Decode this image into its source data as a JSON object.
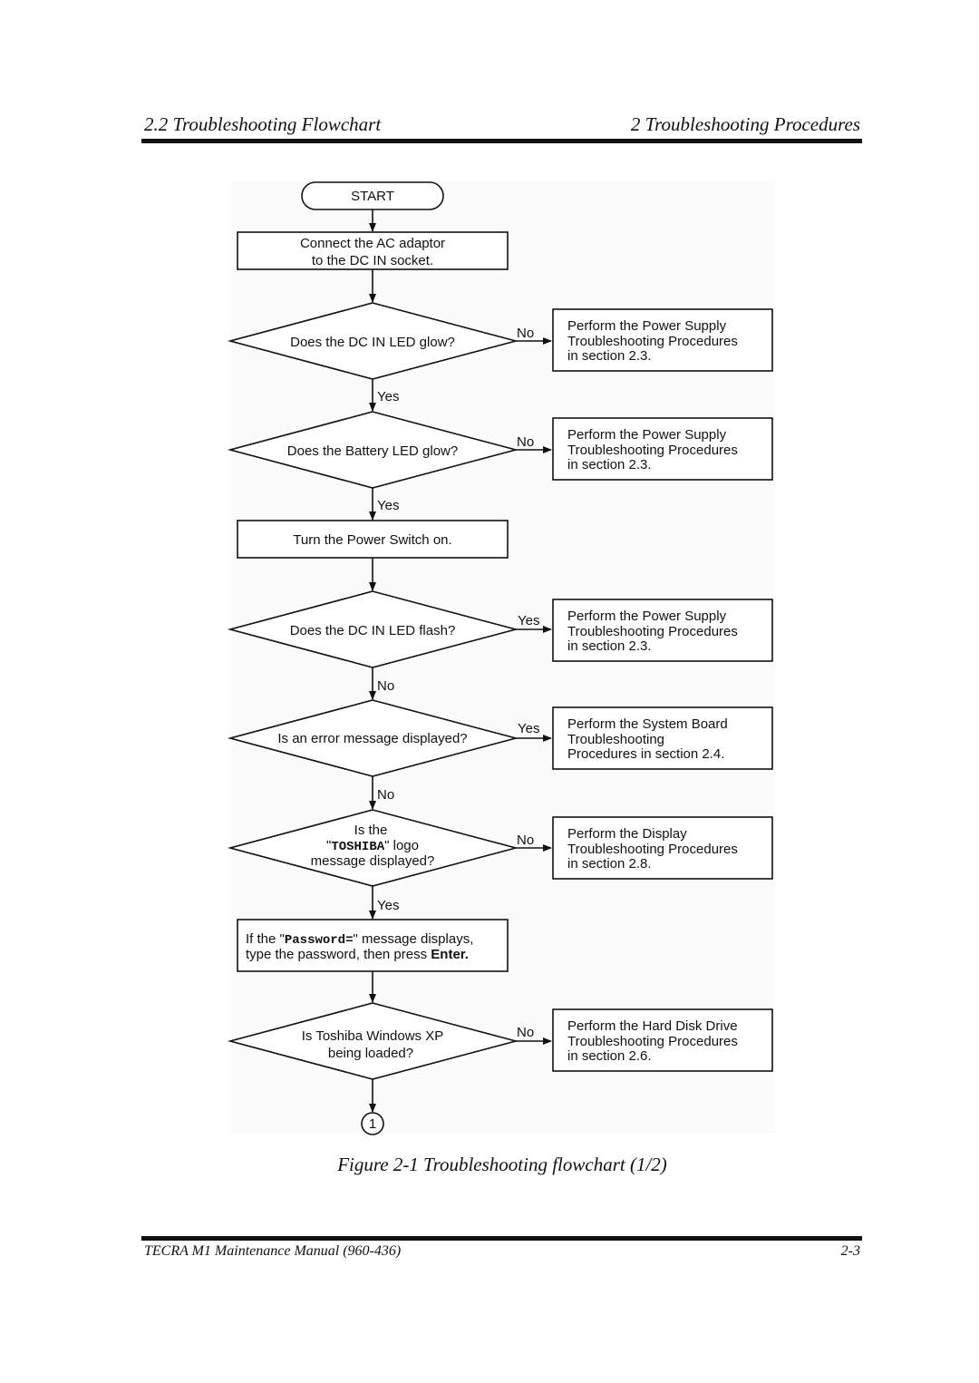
{
  "header": {
    "section_title": "2.2 Troubleshooting Flowchart",
    "chapter_title": "2  Troubleshooting Procedures"
  },
  "flowchart": {
    "start": "START",
    "step_connect": [
      "Connect the AC adaptor",
      "to the DC IN socket."
    ],
    "q1": {
      "text": [
        "Does the DC IN LED glow?"
      ],
      "side_label": "No",
      "down_label": "Yes",
      "action": [
        "Perform the Power Supply",
        "Troubleshooting Procedures",
        "in section 2.3."
      ]
    },
    "q2": {
      "text": [
        "Does the Battery LED glow?"
      ],
      "side_label": "No",
      "down_label": "Yes",
      "action": [
        "Perform the Power Supply",
        "Troubleshooting Procedures",
        "in section 2.3."
      ]
    },
    "step_power": [
      "Turn the Power Switch on."
    ],
    "q3": {
      "text": [
        "Does the DC IN LED flash?"
      ],
      "side_label": "Yes",
      "down_label": "No",
      "action": [
        "Perform the Power Supply",
        "Troubleshooting Procedures",
        "in section 2.3."
      ]
    },
    "q4": {
      "text": [
        "Is an error message displayed?"
      ],
      "side_label": "Yes",
      "down_label": "No",
      "action": [
        "Perform the System Board",
        "Troubleshooting",
        "Procedures in section 2.4."
      ]
    },
    "q5": {
      "line1": "Is the",
      "line2_pre": "\"",
      "line2_mono": "TOSHIBA",
      "line2_post": "\" logo",
      "line3": "message displayed?",
      "side_label": "No",
      "down_label": "Yes",
      "action": [
        "Perform the Display",
        "Troubleshooting Procedures",
        "in section 2.8."
      ]
    },
    "step_password": {
      "l1_pre": "If the \"",
      "l1_mono": "Password=",
      "l1_post": "\" message displays,",
      "l2_pre": "type the password, then press ",
      "l2_bold": "Enter."
    },
    "q6": {
      "text": [
        "Is Toshiba Windows XP",
        "being loaded?"
      ],
      "side_label": "No",
      "action": [
        "Perform the Hard Disk Drive",
        "Troubleshooting Procedures",
        "in section 2.6."
      ]
    },
    "connector": "1"
  },
  "caption": "Figure 2-1  Troubleshooting flowchart (1/2)",
  "footer": {
    "manual": "TECRA M1 Maintenance Manual (960-436)",
    "page": "2-3"
  }
}
